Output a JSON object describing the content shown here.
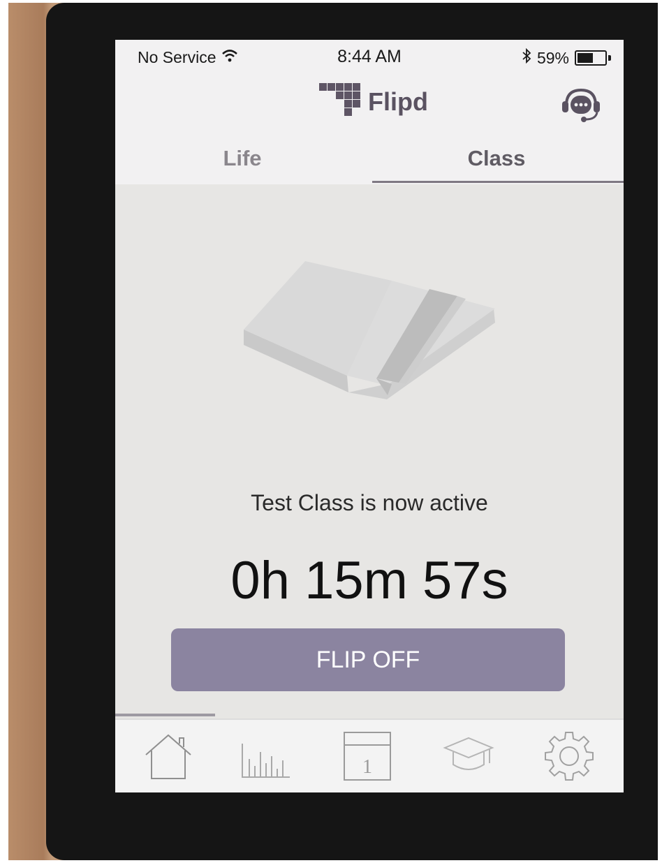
{
  "status_bar": {
    "carrier": "No Service",
    "time": "8:44 AM",
    "battery_percent": "59%",
    "battery_level": 0.59
  },
  "header": {
    "app_name": "Flipd",
    "support_icon": "headset-chat-icon"
  },
  "tabs": [
    {
      "label": "Life",
      "active": false
    },
    {
      "label": "Class",
      "active": true
    }
  ],
  "session": {
    "illustration": "open-book-icon",
    "status_message": "Test Class is now active",
    "timer": "0h 15m 57s",
    "button_label": "FLIP OFF"
  },
  "nav": [
    {
      "name": "home-icon"
    },
    {
      "name": "stats-icon"
    },
    {
      "name": "calendar-icon",
      "label": "1"
    },
    {
      "name": "graduation-cap-icon"
    },
    {
      "name": "settings-gear-icon"
    }
  ],
  "colors": {
    "accent": "#8b84a0",
    "brand_text": "#5a5261",
    "content_bg": "#e7e6e4"
  }
}
